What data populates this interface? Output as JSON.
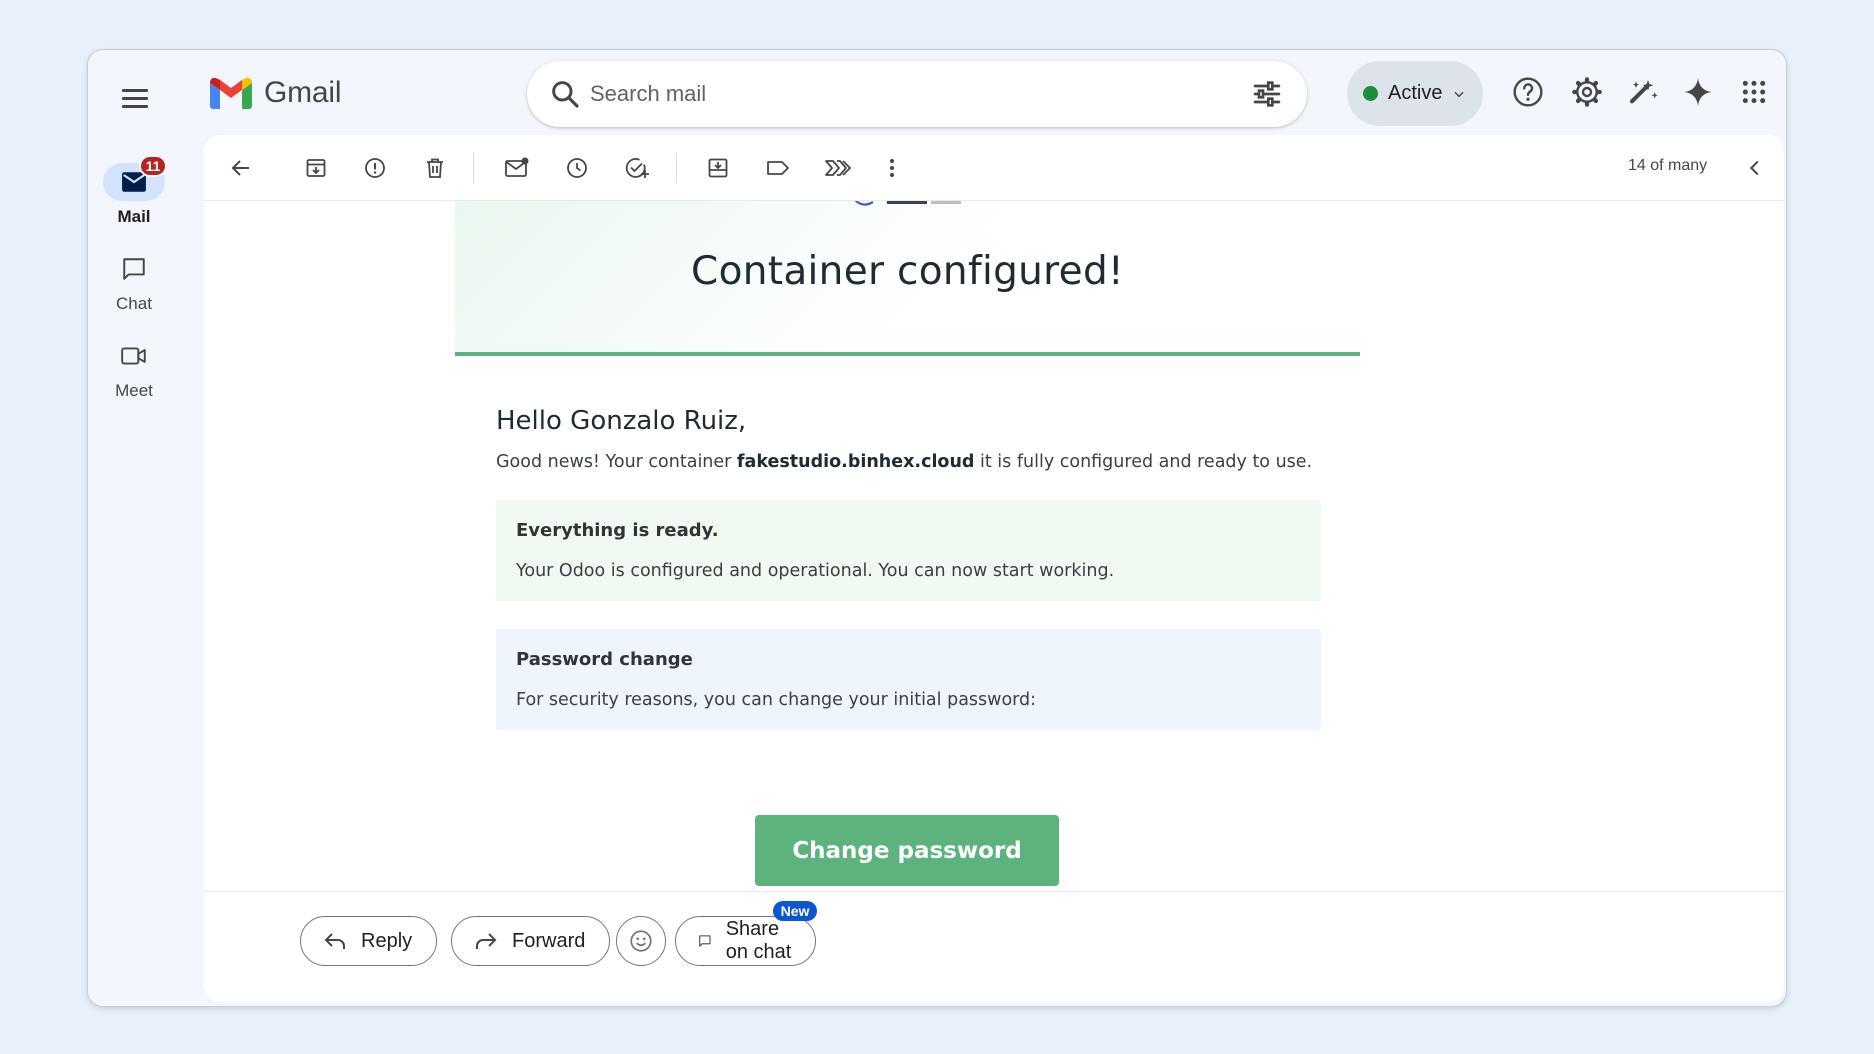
{
  "app": {
    "name": "Gmail"
  },
  "search": {
    "placeholder": "Search mail"
  },
  "status": {
    "label": "Active",
    "color": "#1e8e3e"
  },
  "rail": {
    "items": [
      {
        "label": "Mail",
        "badge": "11",
        "active": true
      },
      {
        "label": "Chat"
      },
      {
        "label": "Meet"
      }
    ]
  },
  "toolbar": {
    "pager": "14 of many"
  },
  "email": {
    "hero_title": "Container configured!",
    "greeting": "Hello Gonzalo Ruiz,",
    "intro_before": "Good news! Your container ",
    "intro_domain": "fakestudio.binhex.cloud",
    "intro_after": " it is fully configured and ready to use.",
    "ready_box": {
      "title": "Everything is ready.",
      "text": "Your Odoo is configured and operational. You can now start working."
    },
    "password_box": {
      "title": "Password change",
      "text": "For security reasons, you can change your initial password:"
    },
    "cta_label": "Change password",
    "accent_color": "#5db37e"
  },
  "actions": {
    "reply": "Reply",
    "forward": "Forward",
    "share": "Share on chat",
    "new_tag": "New"
  }
}
